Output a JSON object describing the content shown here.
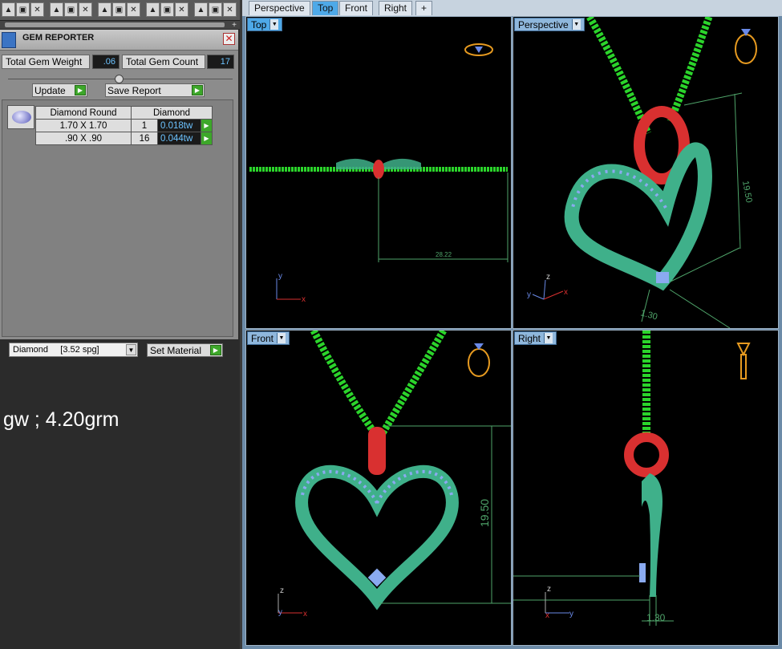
{
  "gem_reporter": {
    "title": "GEM REPORTER",
    "close_icon": "close-icon",
    "total_weight_label": "Total Gem Weight",
    "total_weight_value": ".06",
    "total_count_label": "Total Gem Count",
    "total_count_value": "17",
    "update_label": "Update",
    "save_report_label": "Save Report",
    "table": {
      "headers": [
        "Diamond Round",
        "Diamond"
      ],
      "rows": [
        {
          "size": "1.70 X 1.70",
          "count": "1",
          "weight": "0.018tw"
        },
        {
          "size": ".90 X .90",
          "count": "16",
          "weight": "0.044tw"
        }
      ]
    },
    "material_value": "Diamond     [3.52 spg]",
    "set_material_label": "Set Material"
  },
  "note": "gw ; 4.20grm",
  "tabs": [
    "Perspective",
    "Top",
    "Front",
    "Right",
    "+"
  ],
  "viewports": {
    "top": {
      "label": "Top",
      "dimension": "28.22"
    },
    "perspective": {
      "label": "Perspective",
      "dimension_a": "19.50",
      "dimension_b": "1.30"
    },
    "front": {
      "label": "Front",
      "dimension": "19.50"
    },
    "right": {
      "label": "Right",
      "dimension": "1.30"
    }
  },
  "axes": {
    "x": "x",
    "y": "y",
    "z": "z"
  },
  "colors": {
    "chain": "#2bd42b",
    "bail": "#d93030",
    "pendant": "#3fb08a",
    "stones": "#8aaaf0",
    "dim_line": "#4fa46a"
  }
}
